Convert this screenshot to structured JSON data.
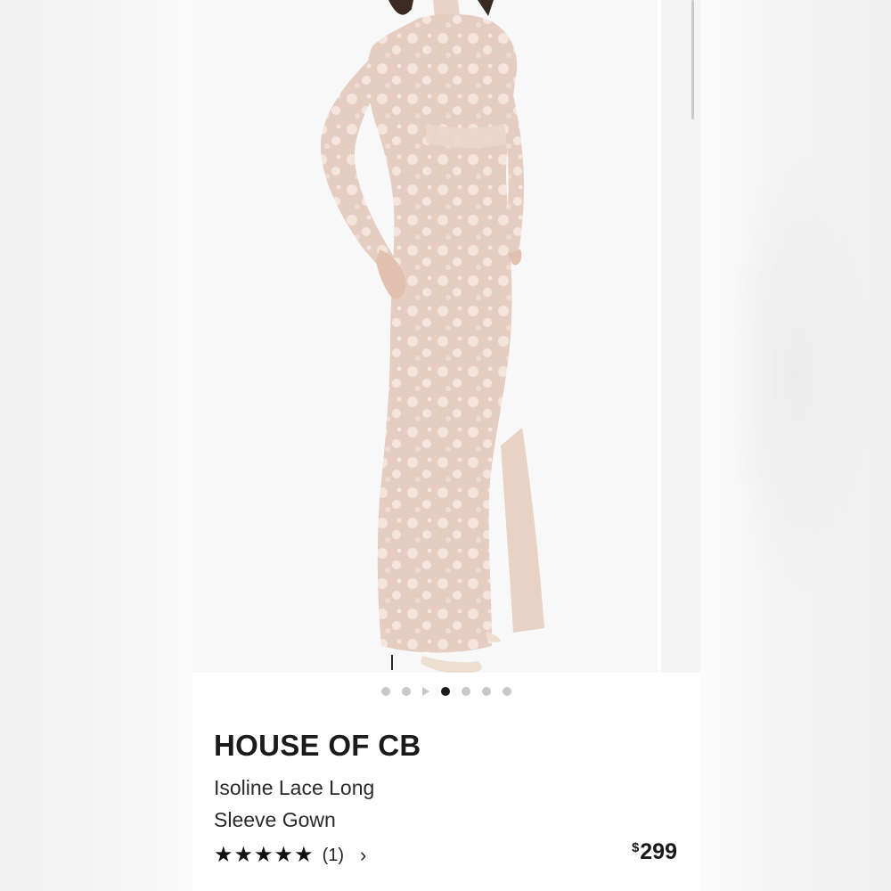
{
  "product": {
    "brand": "HOUSE OF CB",
    "name_line1": "Isoline Lace Long",
    "name_line2": "Sleeve Gown",
    "price_currency": "$",
    "price_amount": "299",
    "rating_stars": 5,
    "review_count": "(1)"
  },
  "gallery": {
    "image_count": 7,
    "active_index": 4,
    "video_index": 2,
    "image_alt": "lace long sleeve gown photo"
  },
  "icons": {
    "star": "star-icon",
    "chevron": "chevron-right-icon",
    "play": "play-icon"
  },
  "colors": {
    "lace": "#efd9d0",
    "lining": "#e2c8bc",
    "dot_active": "#1a1a1a",
    "dot_inactive": "#c8c8c8"
  }
}
